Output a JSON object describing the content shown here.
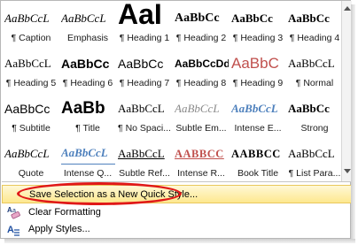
{
  "styles": [
    [
      {
        "preview": "AaBbCcL",
        "label": "¶ Caption"
      },
      {
        "preview": "AaBbCcL",
        "label": "Emphasis"
      },
      {
        "preview": "AaI",
        "label": "¶ Heading 1"
      },
      {
        "preview": "AaBbCc",
        "label": "¶ Heading 2"
      },
      {
        "preview": "AaBbCc",
        "label": "¶ Heading 3"
      },
      {
        "preview": "AaBbCc",
        "label": "¶ Heading 4"
      }
    ],
    [
      {
        "preview": "AaBbCcL",
        "label": "¶ Heading 5"
      },
      {
        "preview": "AaBbCc",
        "label": "¶ Heading 6"
      },
      {
        "preview": "AaBbCc",
        "label": "¶ Heading 7"
      },
      {
        "preview": "AaBbCcDd",
        "label": "¶ Heading 8"
      },
      {
        "preview": "AaBbC",
        "label": "¶ Heading 9"
      },
      {
        "preview": "AaBbCcL",
        "label": "¶ Normal"
      }
    ],
    [
      {
        "preview": "AaBbCc",
        "label": "¶ Subtitle"
      },
      {
        "preview": "AaBb",
        "label": "¶ Title"
      },
      {
        "preview": "AaBbCcL",
        "label": "¶ No Spaci..."
      },
      {
        "preview": "AaBbCcL",
        "label": "Subtle Em..."
      },
      {
        "preview": "AaBbCcL",
        "label": "Intense E..."
      },
      {
        "preview": "AaBbCc",
        "label": "Strong"
      }
    ],
    [
      {
        "preview": "AaBbCcL",
        "label": "Quote"
      },
      {
        "preview": "AaBbCcL",
        "label": "Intense Q..."
      },
      {
        "preview": "AaBbCcL",
        "label": "Subtle Ref..."
      },
      {
        "preview": "AABBCC",
        "label": "Intense R..."
      },
      {
        "preview": "AABBCC",
        "label": "Book Title"
      },
      {
        "preview": "AaBbCcL",
        "label": "¶ List Para..."
      }
    ]
  ],
  "menu": {
    "save_selection": "Save Selection as a New Quick Style...",
    "clear_formatting": "Clear Formatting",
    "apply_styles": "Apply Styles..."
  },
  "icons": {
    "clear_formatting": "eraser-icon",
    "apply_styles": "apply-styles-icon"
  },
  "colors": {
    "highlight": "#fde88f",
    "annotation_ring": "#e01818",
    "heading9_red": "#c0504d",
    "accent_blue": "#4f81bd"
  }
}
